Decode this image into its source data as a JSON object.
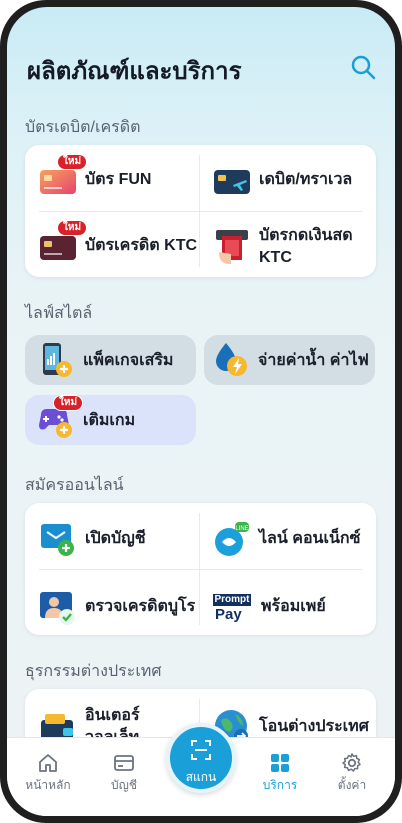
{
  "header": {
    "title": "ผลิตภัณฑ์และบริการ",
    "search_icon": "search-icon"
  },
  "badge_new": "ใหม่",
  "sections": {
    "cards": {
      "title": "บัตรเดบิต/เครดิต",
      "items": [
        {
          "label": "บัตร FUN",
          "icon": "fun-card-icon",
          "is_new": true
        },
        {
          "label": "เดบิต/ทราเวล",
          "icon": "travel-card-icon"
        },
        {
          "label": "บัตรเครดิต KTC",
          "icon": "ktc-card-icon",
          "is_new": true
        },
        {
          "label": "บัตรกดเงินสด KTC",
          "icon": "atm-cash-icon"
        }
      ]
    },
    "lifestyle": {
      "title": "ไลฟ์สไตล์",
      "items": [
        {
          "label": "แพ็คเกจเสริม",
          "icon": "phone-package-icon"
        },
        {
          "label": "จ่ายค่าน้ำ ค่าไฟ",
          "icon": "water-electric-icon"
        },
        {
          "label": "เติมเกม",
          "icon": "game-topup-icon",
          "is_new": true
        }
      ]
    },
    "online": {
      "title": "สมัครออนไลน์",
      "items": [
        {
          "label": "เปิดบัญชี",
          "icon": "open-account-icon"
        },
        {
          "label": "ไลน์ คอนเน็กซ์",
          "icon": "line-connect-icon"
        },
        {
          "label": "ตรวจเครดิตบูโร",
          "icon": "credit-bureau-icon"
        },
        {
          "label": "พร้อมเพย์",
          "icon": "promptpay-icon",
          "logo_top": "Prompt",
          "logo_bottom": "Pay"
        }
      ]
    },
    "international": {
      "title": "ธุรกรรมต่างประเทศ",
      "items": [
        {
          "label": "อินเตอร์วอลเล็ท",
          "icon": "inter-wallet-icon"
        },
        {
          "label": "โอนต่างประเทศ",
          "icon": "globe-transfer-icon"
        }
      ]
    }
  },
  "bottom_nav": {
    "items": [
      {
        "label": "หน้าหลัก",
        "icon": "home-icon"
      },
      {
        "label": "บัญชี",
        "icon": "wallet-icon"
      },
      {
        "label": "สแกน",
        "icon": "scan-icon"
      },
      {
        "label": "บริการ",
        "icon": "services-grid-icon",
        "active": true
      },
      {
        "label": "ตั้งค่า",
        "icon": "settings-gear-icon"
      }
    ]
  },
  "colors": {
    "accent": "#1a9fd8",
    "new_badge": "#d8222a",
    "lifestyle_gray": "#d3dde4",
    "lifestyle_blue": "#dbe3fa"
  }
}
